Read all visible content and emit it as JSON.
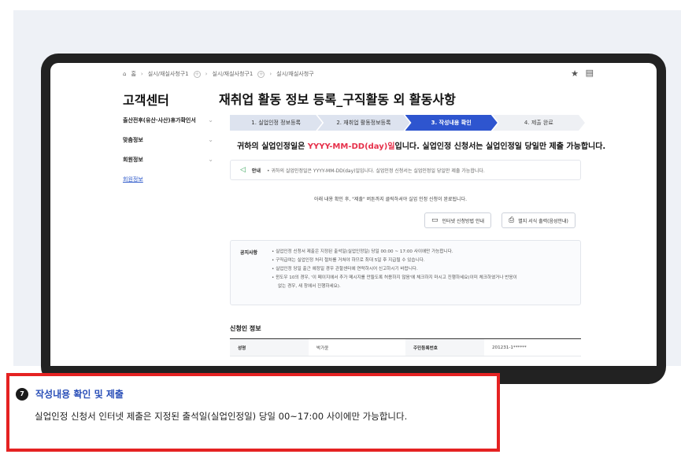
{
  "breadcrumb": {
    "home": "홈",
    "level1": "실시/재실사청구1",
    "level2": "실시/재실사청구1",
    "level3": "실시/재실사청구"
  },
  "icons": {
    "home": "home-icon",
    "star": "star-icon",
    "print": "print-icon",
    "speaker": "megaphone-icon",
    "monitor": "monitor-icon",
    "printer": "printer-icon"
  },
  "sidebar": {
    "title": "고객센터",
    "items": [
      {
        "label": "출산전후(유산·사산)휴가확인서"
      },
      {
        "label": "맞춤정보"
      },
      {
        "label": "회원정보"
      },
      {
        "label": "회원정보"
      }
    ]
  },
  "main": {
    "title": "재취업 활동 정보 등록_구직활동 외 활동사항",
    "steps": [
      {
        "label": "1. 실업인정 정보등록"
      },
      {
        "label": "2. 재취업 활동정보등록"
      },
      {
        "label": "3. 작성내용 확인"
      },
      {
        "label": "4. 제출 완료"
      }
    ],
    "notice_pre": "귀하의 실업인정일은 ",
    "notice_date": "YYYY-MM-DD(day)일",
    "notice_post": "입니다. 실업인정 신청서는 실업인정일 당일만 제출 가능합니다.",
    "guide_label": "안내",
    "guide_text": "• 귀하의 실업인정일은 YYYY-MM-DD(day)일입니다. 실업인정 신청서는 실업인정일 당일만 제출 가능합니다.",
    "center_note": "아래 내용 확인 후, \"제출\" 버튼까지 클릭하셔야 실업 인정 신청이 완료됩니다.",
    "btn_internet": "인터넷 신청방법 안내",
    "btn_print": "별지 서식 출력(음성안내)",
    "notice_label": "공지사항",
    "notices": [
      "• 실업인정 신청서 제출은 지정된 출석일(실업인정일) 당일 00:00 ~ 17:00 사이에만 가능합니다.",
      "• 구직급여는 실업인정 처리 절차를 거쳐야 하므로 최대 5일 후 지급될 수 있습니다.",
      "• 실업인정 당일 출근 예정일 경우 관할센터에 연락하시어 신고하시기 바랍니다.",
      "• 윈도우 10의 경우, '이 페이지에서 추가 메시지를 만들도록 허용하지 않음'에 체크하지 마시고 진행하세요(이미 체크하였거나 반응이",
      "   없는 경우, 새 창에서 진행하세요)."
    ],
    "applicant_title": "신청인 정보",
    "table": {
      "name_label": "성명",
      "name_value": "박가윤",
      "id_label": "주민등록번호",
      "id_value": "201231-1******"
    }
  },
  "caption": {
    "number": "7",
    "title": "작성내용 확인 및 제출",
    "description": "실업인정 신청서 인터넷 제출은 지정된 출석일(실업인정일) 당일 00~17:00 사이에만 가능합니다."
  },
  "colors": {
    "accent": "#2e55cf",
    "highlight_red": "#e6304a",
    "frame_red": "#e52222"
  }
}
